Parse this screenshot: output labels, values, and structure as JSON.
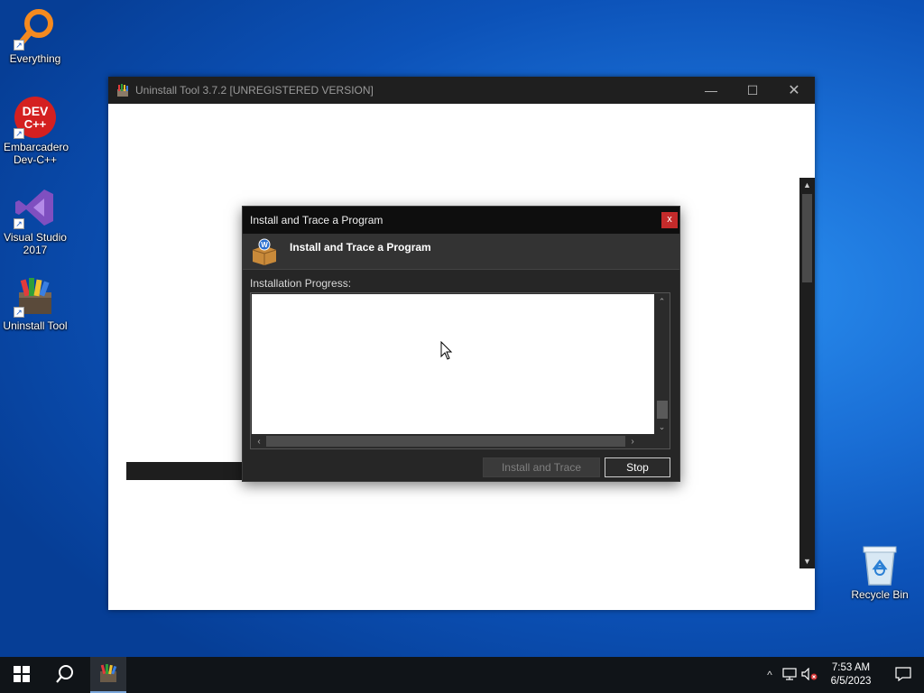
{
  "desktop": {
    "icons": [
      {
        "label": "Everything",
        "icon": "everything-magnifier-icon"
      },
      {
        "label": "Embarcadero Dev-C++",
        "icon": "devcpp-icon"
      },
      {
        "label": "Visual Studio 2017",
        "icon": "visual-studio-icon"
      },
      {
        "label": "Uninstall Tool",
        "icon": "uninstall-tool-icon"
      }
    ],
    "recycle_bin": {
      "label": "Recycle Bin",
      "icon": "recycle-bin-icon"
    }
  },
  "main_window": {
    "title": "Uninstall Tool 3.7.2 [UNREGISTERED VERSION]",
    "minimize": "—",
    "maximize": "☐",
    "close": "✕"
  },
  "dialog": {
    "title": "Install and Trace a Program",
    "close": "x",
    "header_text": "Install and Trace a Program",
    "progress_label": "Installation Progress:",
    "progress_entries": [],
    "buttons": {
      "install_and_trace": "Install and Trace",
      "install_and_trace_enabled": false,
      "stop": "Stop"
    }
  },
  "taskbar": {
    "start": "start-windows-icon",
    "search": "search-icon",
    "pinned_app": "uninstall-tool-icon",
    "clock_time": "7:53 AM",
    "clock_date": "6/5/2023",
    "tray": {
      "chevron": "^",
      "network": "network-icon",
      "volume": "volume-muted-icon",
      "notifications": "notification-icon"
    }
  },
  "colors": {
    "dialog_bg": "#262626",
    "dialog_title_bg": "#0e0e0e",
    "close_red": "#c42b2b",
    "desktop_blue": "#1a6fd6"
  }
}
